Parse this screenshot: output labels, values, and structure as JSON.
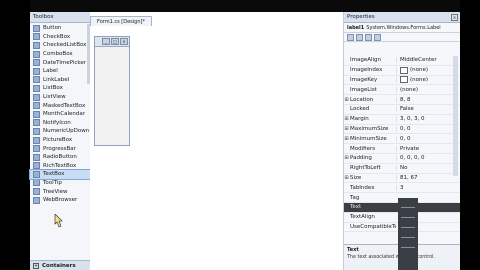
{
  "toolbox": {
    "title": "Toolbox",
    "items": [
      "Button",
      "CheckBox",
      "CheckedListBox",
      "ComboBox",
      "DateTimePicker",
      "Label",
      "LinkLabel",
      "ListBox",
      "ListView",
      "MaskedTextBox",
      "MonthCalendar",
      "NotifyIcon",
      "NumericUpDown",
      "PictureBox",
      "ProgressBar",
      "RadioButton",
      "RichTextBox",
      "TextBox",
      "ToolTip",
      "TreeView",
      "WebBrowser"
    ],
    "selected_index": 17,
    "group_label": "Containers"
  },
  "designer": {
    "tab_label": "Form1.cs [Design]*"
  },
  "properties": {
    "title": "Properties",
    "object_name": "label1",
    "object_type": "System.Windows.Forms.Label",
    "rows": [
      {
        "exp": "",
        "name": "ImageAlign",
        "value": "MiddleCenter",
        "swatch": false
      },
      {
        "exp": "",
        "name": "ImageIndex",
        "value": "(none)",
        "swatch": true
      },
      {
        "exp": "",
        "name": "ImageKey",
        "value": "(none)",
        "swatch": true
      },
      {
        "exp": "",
        "name": "ImageList",
        "value": "(none)",
        "swatch": false
      },
      {
        "exp": "⊞",
        "name": "Location",
        "value": "8, 8",
        "swatch": false
      },
      {
        "exp": "",
        "name": "Locked",
        "value": "False",
        "swatch": false
      },
      {
        "exp": "⊞",
        "name": "Margin",
        "value": "3, 0, 3, 0",
        "swatch": false
      },
      {
        "exp": "⊞",
        "name": "MaximumSize",
        "value": "0, 0",
        "swatch": false
      },
      {
        "exp": "⊞",
        "name": "MinimumSize",
        "value": "0, 0",
        "swatch": false
      },
      {
        "exp": "",
        "name": "Modifiers",
        "value": "Private",
        "swatch": false
      },
      {
        "exp": "⊞",
        "name": "Padding",
        "value": "0, 0, 0, 0",
        "swatch": false
      },
      {
        "exp": "",
        "name": "RightToLeft",
        "value": "No",
        "swatch": false
      },
      {
        "exp": "⊞",
        "name": "Size",
        "value": "81, 67",
        "swatch": false
      },
      {
        "exp": "",
        "name": "TabIndex",
        "value": "3",
        "swatch": false
      },
      {
        "exp": "",
        "name": "Tag",
        "value": "",
        "swatch": false
      },
      {
        "exp": "",
        "name": "Text",
        "value": "",
        "swatch": false
      },
      {
        "exp": "",
        "name": "TextAlign",
        "value": "",
        "swatch": false
      },
      {
        "exp": "",
        "name": "UseCompatibleTextRendering",
        "value": "",
        "swatch": false
      }
    ],
    "help_title": "Text",
    "help_text": "The text associated with the control."
  }
}
